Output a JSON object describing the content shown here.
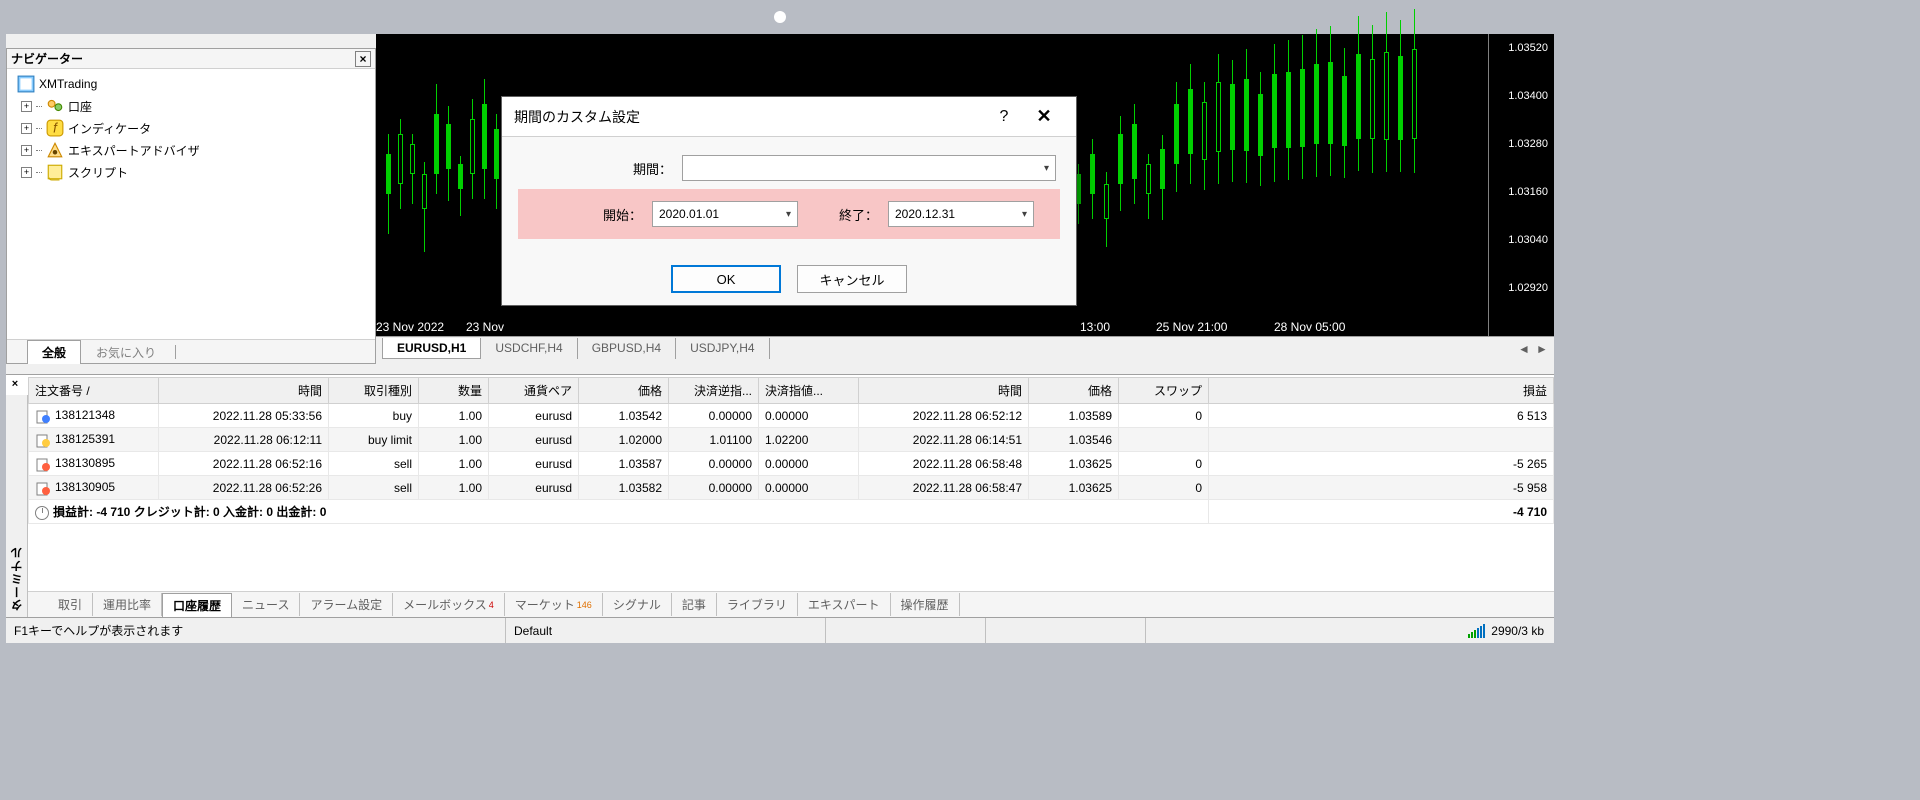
{
  "navigator": {
    "title": "ナビゲーター",
    "root": "XMTrading",
    "items": [
      {
        "label": "口座",
        "icon": "accounts"
      },
      {
        "label": "インディケータ",
        "icon": "indicator"
      },
      {
        "label": "エキスパートアドバイザ",
        "icon": "ea"
      },
      {
        "label": "スクリプト",
        "icon": "script"
      }
    ],
    "tabs": {
      "general": "全般",
      "favorites": "お気に入り"
    }
  },
  "chart": {
    "price_ticks": [
      "1.03520",
      "1.03400",
      "1.03280",
      "1.03160",
      "1.03040",
      "1.02920"
    ],
    "time_ticks": [
      {
        "pos": 0,
        "label": "23 Nov 2022"
      },
      {
        "pos": 90,
        "label": "23 Nov"
      },
      {
        "pos": 704,
        "label": "13:00"
      },
      {
        "pos": 780,
        "label": "25 Nov 21:00"
      },
      {
        "pos": 898,
        "label": "28 Nov 05:00"
      }
    ],
    "tabs": [
      "EURUSD,H1",
      "USDCHF,H4",
      "GBPUSD,H4",
      "USDJPY,H4"
    ]
  },
  "dialog": {
    "title": "期間のカスタム設定",
    "period_label": "期間：",
    "start_label": "開始：",
    "end_label": "終了：",
    "start_value": "2020.01.01",
    "end_value": "2020.12.31",
    "ok": "OK",
    "cancel": "キャンセル"
  },
  "terminal": {
    "label": "ターミナル",
    "columns": [
      "注文番号",
      "時間",
      "取引種別",
      "数量",
      "通貨ペア",
      "価格",
      "決済逆指...",
      "決済指値...",
      "時間",
      "価格",
      "スワップ",
      "損益"
    ],
    "rows": [
      {
        "order": "138121348",
        "time": "2022.11.28 05:33:56",
        "type": "buy",
        "vol": "1.00",
        "sym": "eurusd",
        "price": "1.03542",
        "sl": "0.00000",
        "tp": "0.00000",
        "ctime": "2022.11.28 06:52:12",
        "cprice": "1.03589",
        "swap": "0",
        "pl": "6 513",
        "typ": "buy"
      },
      {
        "order": "138125391",
        "time": "2022.11.28 06:12:11",
        "type": "buy limit",
        "vol": "1.00",
        "sym": "eurusd",
        "price": "1.02000",
        "sl": "1.01100",
        "tp": "1.02200",
        "ctime": "2022.11.28 06:14:51",
        "cprice": "1.03546",
        "swap": "",
        "pl": "",
        "typ": "pend"
      },
      {
        "order": "138130895",
        "time": "2022.11.28 06:52:16",
        "type": "sell",
        "vol": "1.00",
        "sym": "eurusd",
        "price": "1.03587",
        "sl": "0.00000",
        "tp": "0.00000",
        "ctime": "2022.11.28 06:58:48",
        "cprice": "1.03625",
        "swap": "0",
        "pl": "-5 265",
        "typ": "sell"
      },
      {
        "order": "138130905",
        "time": "2022.11.28 06:52:26",
        "type": "sell",
        "vol": "1.00",
        "sym": "eurusd",
        "price": "1.03582",
        "sl": "0.00000",
        "tp": "0.00000",
        "ctime": "2022.11.28 06:58:47",
        "cprice": "1.03625",
        "swap": "0",
        "pl": "-5 958",
        "typ": "sell"
      }
    ],
    "summary": "損益計: -4 710  クレジット計: 0  入金計: 0  出金計: 0",
    "summary_total": "-4 710",
    "tabs": [
      "取引",
      "運用比率",
      "口座履歴",
      "ニュース",
      "アラーム設定",
      "メールボックス",
      "マーケット",
      "シグナル",
      "記事",
      "ライブラリ",
      "エキスパート",
      "操作履歴"
    ],
    "active_tab": "口座履歴",
    "mail_badge": "4",
    "market_badge": "146"
  },
  "statusbar": {
    "help": "F1キーでヘルプが表示されます",
    "profile": "Default",
    "connection": "2990/3 kb"
  }
}
